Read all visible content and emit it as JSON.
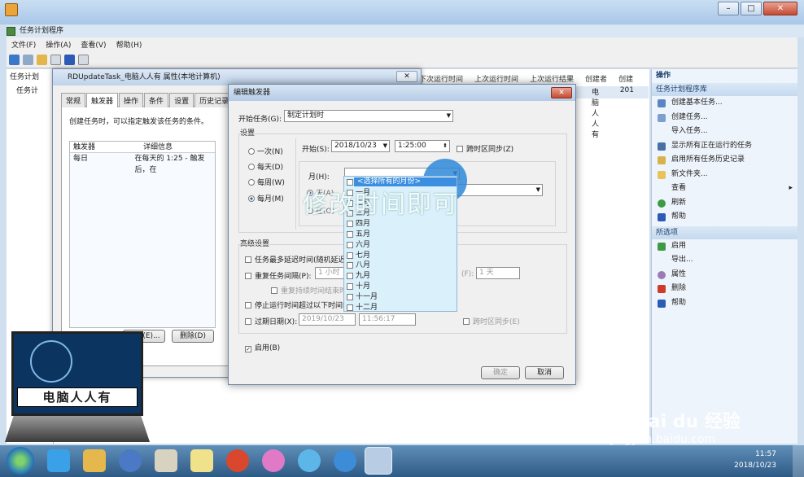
{
  "app": {
    "title": "任务计划程序",
    "menu": [
      "文件(F)",
      "操作(A)",
      "查看(V)",
      "帮助(H)"
    ],
    "tree": [
      "任务计划",
      "任务计"
    ]
  },
  "list": {
    "headers": [
      "下次运行时间",
      "上次运行时间",
      "上次运行结果",
      "创建者",
      "创建"
    ],
    "row": [
      "电脑人人有",
      "201"
    ]
  },
  "actions": {
    "title": "操作",
    "section1": "任务计划程序库",
    "items1": [
      "创建基本任务...",
      "创建任务...",
      "导入任务...",
      "显示所有正在运行的任务",
      "启用所有任务历史记录",
      "新文件夹...",
      "查看",
      "刷新",
      "帮助"
    ],
    "section2": "所选项",
    "items2": [
      "启用",
      "导出...",
      "属性",
      "删除",
      "帮助"
    ]
  },
  "props": {
    "title": "RDUpdateTask_电脑人人有 属性(本地计算机)",
    "tabs": [
      "常规",
      "触发器",
      "操作",
      "条件",
      "设置",
      "历史记录"
    ],
    "description": "创建任务时，可以指定触发该任务的条件。",
    "table_headers": [
      "触发器",
      "详细信息"
    ],
    "table_row": [
      "每日",
      "在每天的 1:25 - 触发后，在"
    ],
    "edit_button": "编辑(E)...",
    "delete_button": "删除(D)"
  },
  "edit": {
    "title": "编辑触发器",
    "begin_label": "开始任务(G):",
    "begin_value": "制定计划时",
    "settings_label": "设置",
    "radios": [
      "一次(N)",
      "每天(D)",
      "每周(W)",
      "每月(M)"
    ],
    "start_label": "开始(S):",
    "start_date": "2018/10/23",
    "start_time": "1:25:00",
    "sync_label": "跨时区同步(Z)",
    "month_label": "月(H):",
    "sub_radio1": "天(A)",
    "sub_radio2": "在(O)",
    "advanced_label": "高级设置",
    "adv1": "任务最多延迟时间(随机延迟)(",
    "adv2": "重复任务间隔(P):",
    "adv2_value": "1 小时",
    "adv2_right": "(F):",
    "adv2_right_value": "1 天",
    "adv3": "重复持续时间结束时",
    "adv4": "停止运行时间超过以下时间的",
    "expire_label": "过期日期(X):",
    "expire_date": "2019/10/23",
    "expire_time": "11:56:17",
    "expire_sync": "跨时区同步(E)",
    "enabled_label": "启用(B)",
    "ok": "确定",
    "cancel": "取消"
  },
  "dropdown": {
    "select_all": "<选择所有的月份>",
    "months": [
      "一月",
      "二月",
      "三月",
      "四月",
      "五月",
      "六月",
      "七月",
      "八月",
      "九月",
      "十月",
      "十一月",
      "十二月"
    ]
  },
  "overlay": "修改时间即可",
  "logo_text": "电脑人人有",
  "clock": {
    "time": "11:57",
    "date": "2018/10/23"
  },
  "watermark": {
    "brand": "Bai du 经验",
    "url": "jingyan.baidu.com"
  },
  "colors": {
    "accent": "#3c8fe0",
    "taskbar": "#2e5a86",
    "actions_bg": "#eef4fb"
  }
}
